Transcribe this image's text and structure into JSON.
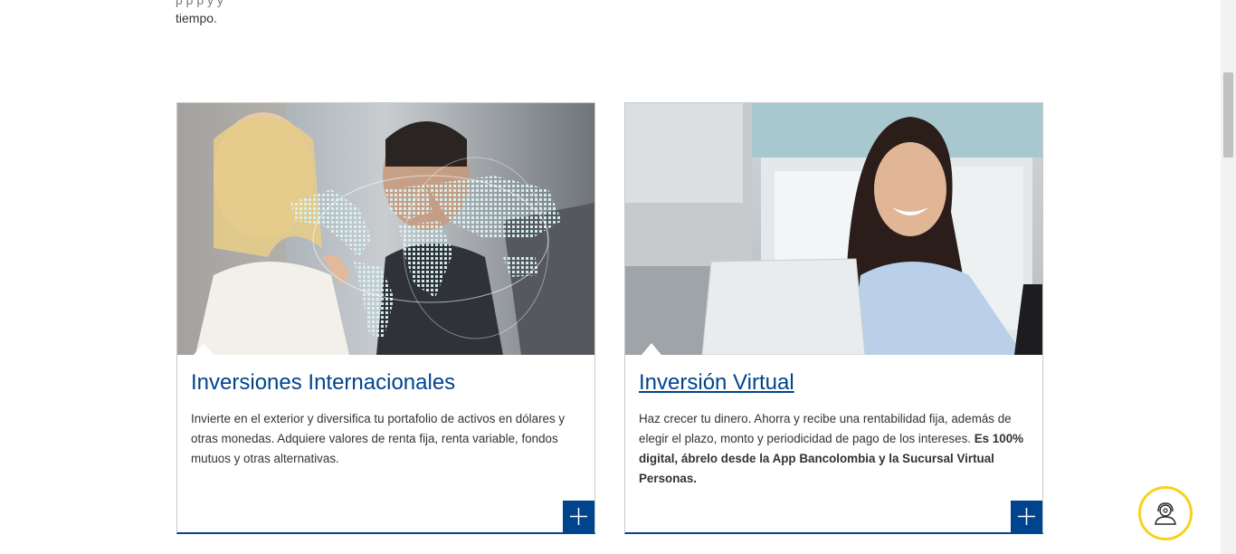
{
  "intro": {
    "line1_partial": "p   p   p            y            y",
    "line2": "tiempo."
  },
  "cards": [
    {
      "title": "Inversiones Internacionales",
      "body": "Invierte en el exterior y diversifica tu portafolio de activos en dólares y otras monedas. Adquiere valores de renta fija, renta variable, fondos mutuos  y otras alternativas.",
      "button_icon": "plus-icon"
    },
    {
      "title": "Inversión Virtual",
      "body": "Haz crecer tu dinero. Ahorra y recibe una rentabilidad fija, además de elegir el plazo, monto y periodicidad de pago de los intereses. ",
      "body_bold": "Es 100% digital, ábrelo desde la App Bancolombia y la Sucursal Virtual Personas.",
      "button_icon": "plus-icon"
    }
  ],
  "help_button": {
    "icon": "support-agent-icon"
  },
  "colors": {
    "brand_blue": "#00448d",
    "accent_yellow": "#f7d21b"
  }
}
